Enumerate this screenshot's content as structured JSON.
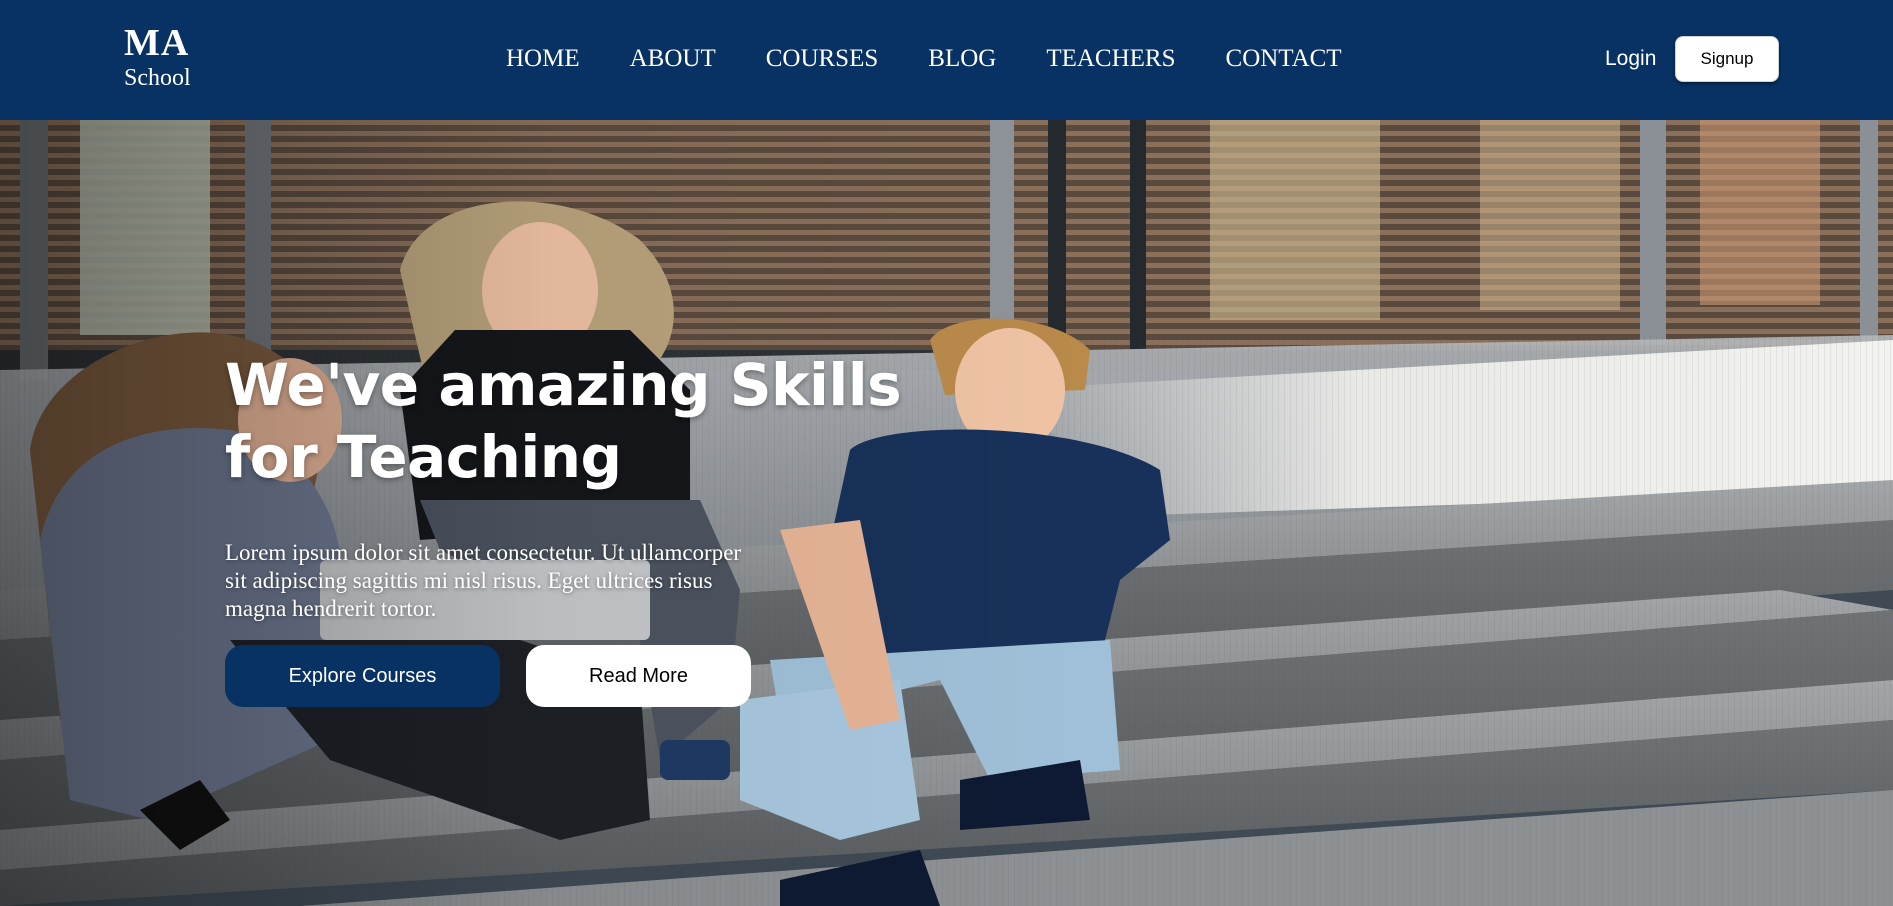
{
  "brand": {
    "name": "MA",
    "subtitle": "School"
  },
  "nav": {
    "links": [
      "HOME",
      "ABOUT",
      "COURSES",
      "BLOG",
      "TEACHERS",
      "CONTACT"
    ],
    "login_label": "Login",
    "signup_label": "Signup"
  },
  "hero": {
    "title_line1": "We've amazing Skills",
    "title_line2": "for Teaching",
    "description": "Lorem ipsum dolor sit amet consectetur. Ut ullamcorper sit adipiscing sagittis mi nisl risus. Eget ultrices risus magna hendrerit tortor.",
    "primary_button": "Explore Courses",
    "secondary_button": "Read More",
    "image_alt": "three-students-sitting-on-steps"
  },
  "colors": {
    "navbar": "#073263",
    "primary_button": "#073263",
    "secondary_button": "#ffffff",
    "text_light": "#ffffff"
  }
}
